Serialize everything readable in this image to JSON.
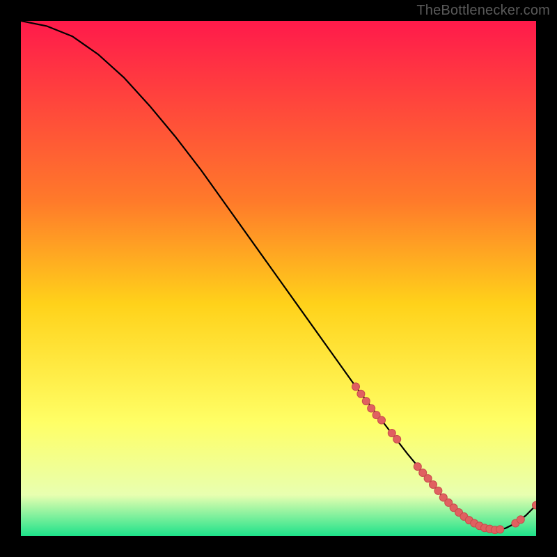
{
  "watermark": "TheBottlenecker.com",
  "colors": {
    "bg_black": "#000000",
    "grad_top": "#ff1a4b",
    "grad_mid1": "#ff7a2a",
    "grad_mid2": "#ffd21a",
    "grad_mid3": "#ffff66",
    "grad_mid4": "#e8ffb0",
    "grad_bottom": "#1de28a",
    "curve": "#000000",
    "marker_fill": "#e06060",
    "marker_stroke": "#c74b4b"
  },
  "chart_data": {
    "type": "line",
    "title": "",
    "xlabel": "",
    "ylabel": "",
    "xlim": [
      0,
      100
    ],
    "ylim": [
      0,
      100
    ],
    "curve": {
      "x": [
        0,
        5,
        10,
        15,
        20,
        25,
        30,
        35,
        40,
        45,
        50,
        55,
        60,
        65,
        70,
        75,
        80,
        82,
        84,
        86,
        88,
        90,
        92,
        94,
        96,
        98,
        100
      ],
      "y": [
        100,
        99,
        97,
        93.5,
        89,
        83.5,
        77.5,
        71,
        64,
        57,
        50,
        43,
        36,
        29,
        22.5,
        16,
        10,
        7.5,
        5.5,
        3.8,
        2.5,
        1.6,
        1.2,
        1.5,
        2.5,
        4,
        6
      ]
    },
    "markers": {
      "x": [
        65,
        66,
        67,
        68,
        69,
        70,
        72,
        73,
        77,
        78,
        79,
        80,
        81,
        82,
        83,
        84,
        85,
        86,
        87,
        88,
        89,
        90,
        91,
        92,
        93,
        96,
        97,
        100
      ],
      "y": [
        29,
        27.6,
        26.2,
        24.8,
        23.5,
        22.5,
        20,
        18.8,
        13.5,
        12.3,
        11.2,
        10,
        8.8,
        7.5,
        6.5,
        5.5,
        4.6,
        3.8,
        3.1,
        2.5,
        2.0,
        1.6,
        1.4,
        1.2,
        1.3,
        2.5,
        3.2,
        6
      ]
    }
  }
}
